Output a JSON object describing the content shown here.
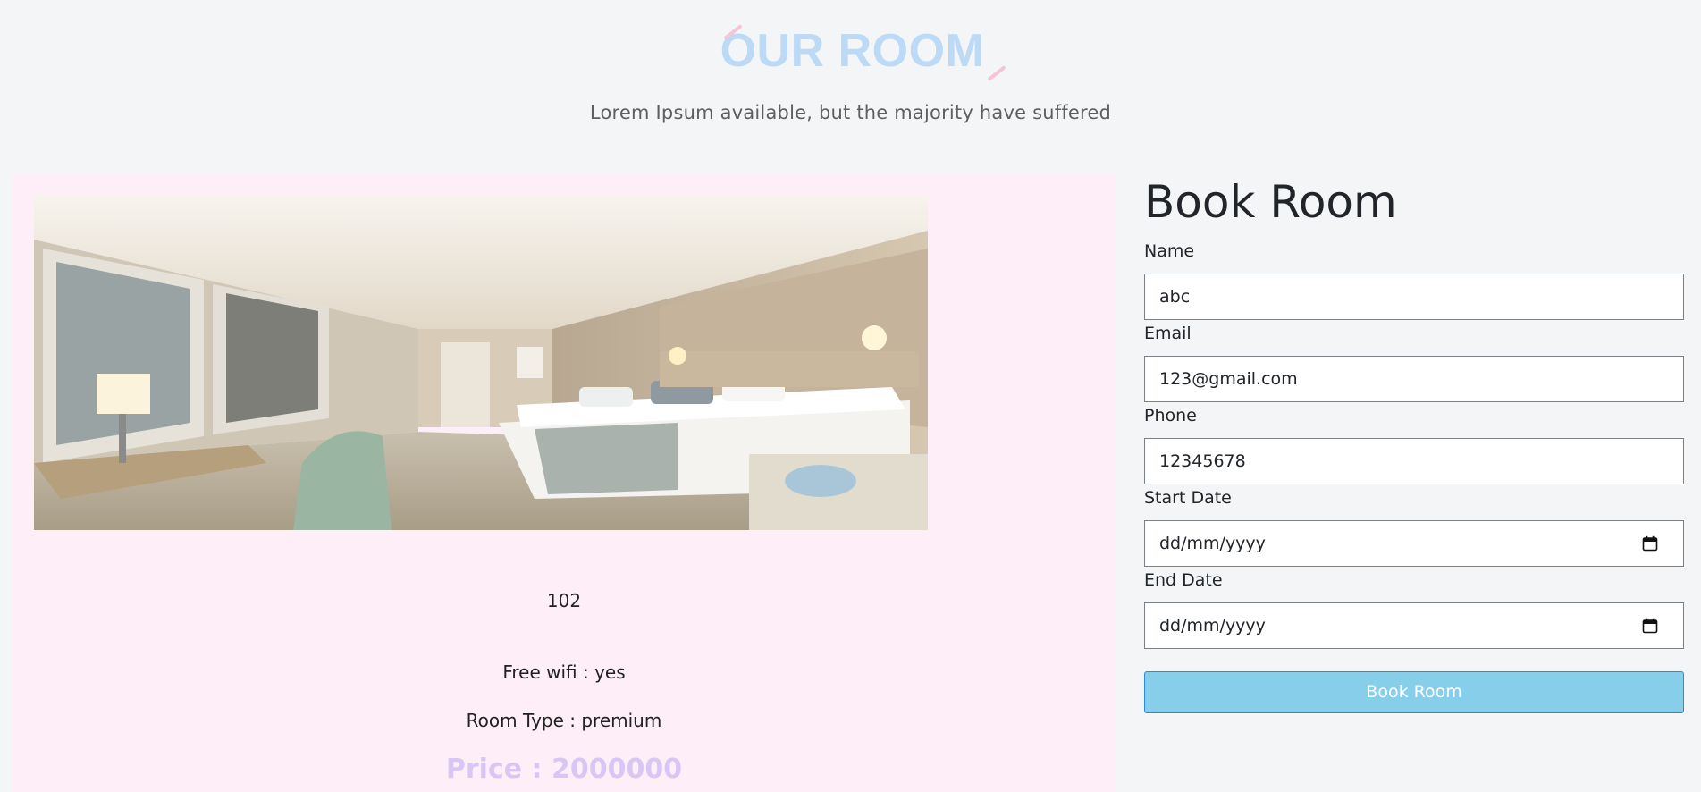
{
  "header": {
    "title": "OUR ROOM",
    "subtitle": "Lorem Ipsum available, but the majority have suffered"
  },
  "room": {
    "image_alt": "hotel room photo",
    "number": "102",
    "wifi": "Free wifi : yes",
    "type": "Room Type : premium",
    "price": "Price : 2000000"
  },
  "form": {
    "heading": "Book Room",
    "name_label": "Name",
    "name_value": "abc",
    "email_label": "Email",
    "email_value": "123@gmail.com",
    "phone_label": "Phone",
    "phone_value": "12345678",
    "start_label": "Start Date",
    "start_placeholder": "dd/mm/yyyy",
    "end_label": "End Date",
    "end_placeholder": "dd/mm/yyyy",
    "submit_label": "Book Room"
  },
  "icons": {
    "calendar": "calendar-icon"
  },
  "colors": {
    "title": "#bcd9f6",
    "title_accent": "#f7c4d5",
    "card_bg": "#fdeef7",
    "price": "#d9c6f4",
    "button_bg": "#87ceeb",
    "button_border": "#2a8ce0"
  }
}
